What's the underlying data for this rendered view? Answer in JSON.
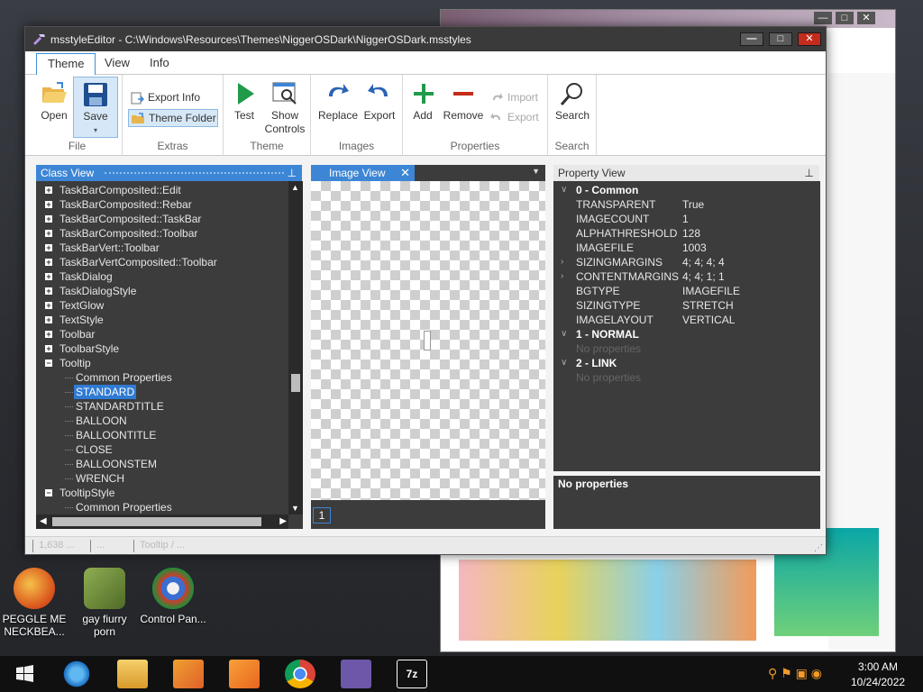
{
  "window": {
    "title": "msstyleEditor - C:\\Windows\\Resources\\Themes\\NiggerOSDark\\NiggerOSDark.msstyles",
    "minimize": "—",
    "maximize": "□",
    "close": "✕"
  },
  "ribbon_tabs": [
    "Theme",
    "View",
    "Info"
  ],
  "ribbon": {
    "file": {
      "label": "File",
      "open": "Open",
      "save": "Save"
    },
    "extras": {
      "label": "Extras",
      "export_info": "Export Info",
      "theme_folder": "Theme Folder"
    },
    "theme": {
      "label": "Theme",
      "test": "Test",
      "show_controls_1": "Show",
      "show_controls_2": "Controls"
    },
    "images": {
      "label": "Images",
      "replace": "Replace",
      "export": "Export"
    },
    "properties": {
      "label": "Properties",
      "add": "Add",
      "remove": "Remove",
      "import": "Import",
      "export": "Export"
    },
    "search": {
      "label": "Search",
      "search": "Search"
    }
  },
  "class_view": {
    "title": "Class View",
    "rows": [
      {
        "label": "TaskBarComposited::Edit",
        "level": 0,
        "exp": "+"
      },
      {
        "label": "TaskBarComposited::Rebar",
        "level": 0,
        "exp": "+"
      },
      {
        "label": "TaskBarComposited::TaskBar",
        "level": 0,
        "exp": "+"
      },
      {
        "label": "TaskBarComposited::Toolbar",
        "level": 0,
        "exp": "+"
      },
      {
        "label": "TaskBarVert::Toolbar",
        "level": 0,
        "exp": "+"
      },
      {
        "label": "TaskBarVertComposited::Toolbar",
        "level": 0,
        "exp": "+"
      },
      {
        "label": "TaskDialog",
        "level": 0,
        "exp": "+"
      },
      {
        "label": "TaskDialogStyle",
        "level": 0,
        "exp": "+"
      },
      {
        "label": "TextGlow",
        "level": 0,
        "exp": "+"
      },
      {
        "label": "TextStyle",
        "level": 0,
        "exp": "+"
      },
      {
        "label": "Toolbar",
        "level": 0,
        "exp": "+"
      },
      {
        "label": "ToolbarStyle",
        "level": 0,
        "exp": "+"
      },
      {
        "label": "Tooltip",
        "level": 0,
        "exp": "−"
      },
      {
        "label": "Common Properties",
        "level": 1
      },
      {
        "label": "STANDARD",
        "level": 1,
        "selected": true
      },
      {
        "label": "STANDARDTITLE",
        "level": 1
      },
      {
        "label": "BALLOON",
        "level": 1
      },
      {
        "label": "BALLOONTITLE",
        "level": 1
      },
      {
        "label": "CLOSE",
        "level": 1
      },
      {
        "label": "BALLOONSTEM",
        "level": 1
      },
      {
        "label": "WRENCH",
        "level": 1
      },
      {
        "label": "TooltipStyle",
        "level": 0,
        "exp": "−"
      },
      {
        "label": "Common Properties",
        "level": 1
      }
    ]
  },
  "image_view": {
    "title": "Image View",
    "index": "1"
  },
  "property_view": {
    "title": "Property View",
    "rows": [
      {
        "type": "head",
        "key": "0 - Common"
      },
      {
        "key": "TRANSPARENT",
        "value": "True"
      },
      {
        "key": "IMAGECOUNT",
        "value": "1"
      },
      {
        "key": "ALPHATHRESHOLD",
        "value": "128"
      },
      {
        "key": "IMAGEFILE",
        "value": "1003"
      },
      {
        "key": "SIZINGMARGINS",
        "value": "4; 4; 4; 4",
        "chev": true
      },
      {
        "key": "CONTENTMARGINS",
        "value": "4; 4; 1; 1",
        "chev": true
      },
      {
        "key": "BGTYPE",
        "value": "IMAGEFILE"
      },
      {
        "key": "SIZINGTYPE",
        "value": "STRETCH"
      },
      {
        "key": "IMAGELAYOUT",
        "value": "VERTICAL"
      },
      {
        "type": "head",
        "key": "1 - NORMAL"
      },
      {
        "type": "empty",
        "key": "No properties"
      },
      {
        "type": "head",
        "key": "2 - LINK"
      },
      {
        "type": "empty",
        "key": "No properties"
      }
    ],
    "description": "No properties"
  },
  "status": [
    "1,638 ...",
    "...",
    "Tooltip / ..."
  ],
  "desktop_icons": [
    {
      "label1": "PEGGLE ME",
      "label2": "NECKBEA...",
      "color": "#e04c1a"
    },
    {
      "label1": "gay fiurry",
      "label2": "porn",
      "color": "#6b8f3a"
    },
    {
      "label1": "Control Pan...",
      "label2": "",
      "color": "#3a6fd0"
    }
  ],
  "clock": {
    "time": "3:00 AM",
    "date": "10/24/2022"
  },
  "colors": {
    "accent": "#3d86d6",
    "dark_panel": "#3c3c3c",
    "close": "#c42b1c"
  }
}
